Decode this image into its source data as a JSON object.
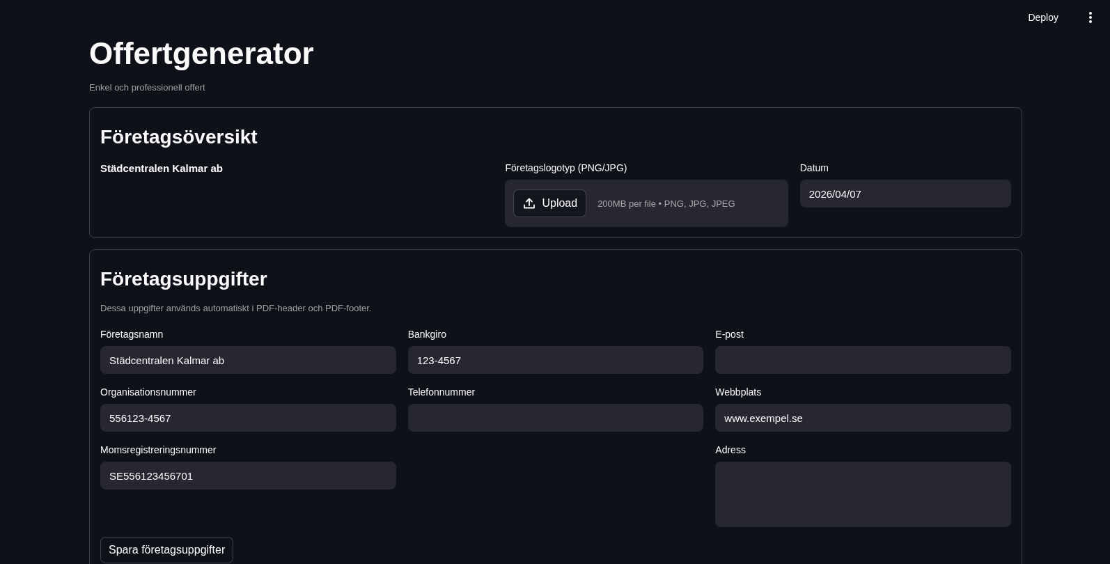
{
  "header": {
    "deploy_button": "Deploy"
  },
  "page": {
    "title": "Offertgenerator",
    "subtitle": "Enkel och professionell offert"
  },
  "company_overview": {
    "heading": "Företagsöversikt",
    "company_name": "Städcentralen Kalmar ab",
    "logo_upload": {
      "label": "Företagslogotyp (PNG/JPG)",
      "button": "Upload",
      "hint": "200MB per file • PNG, JPG, JPEG"
    },
    "date": {
      "label": "Datum",
      "value": "2026/04/07"
    }
  },
  "company_details": {
    "heading": "Företagsuppgifter",
    "caption": "Dessa uppgifter används automatiskt i PDF-header och PDF-footer.",
    "columns": [
      [
        {
          "label": "Företagsnamn",
          "value": "Städcentralen Kalmar ab",
          "kind": "text"
        },
        {
          "label": "Organisationsnummer",
          "value": "556123-4567",
          "kind": "text"
        },
        {
          "label": "Momsregistreringsnummer",
          "value": "SE556123456701",
          "kind": "text"
        }
      ],
      [
        {
          "label": "Bankgiro",
          "value": "123-4567",
          "kind": "text"
        },
        {
          "label": "Telefonnummer",
          "kind": "text"
        }
      ],
      [
        {
          "label": "E-post",
          "kind": "text"
        },
        {
          "label": "Webbplats",
          "value": "www.exempel.se",
          "kind": "text"
        },
        {
          "label": "Adress",
          "kind": "textarea"
        }
      ]
    ],
    "save_button": "Spara företagsuppgifter"
  }
}
